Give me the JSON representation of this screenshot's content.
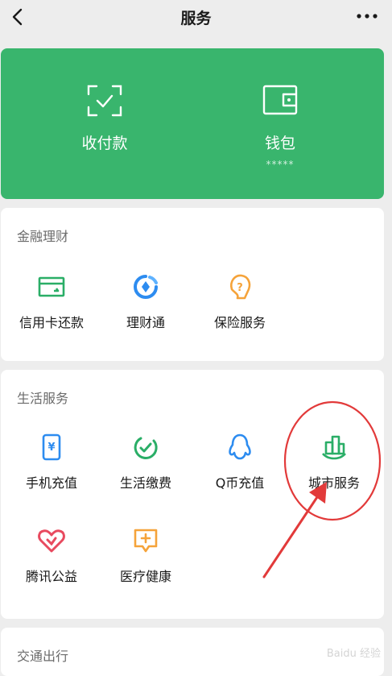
{
  "header": {
    "title": "服务",
    "back_icon": "chevron-left-icon",
    "more_icon": "more-dots-icon"
  },
  "top_card": {
    "color": "#39b56d",
    "items": [
      {
        "label": "收付款",
        "icon": "scan-qr-icon"
      },
      {
        "label": "钱包",
        "icon": "wallet-icon",
        "sub": "*****"
      }
    ]
  },
  "finance": {
    "title": "金融理财",
    "items": [
      {
        "label": "信用卡还款",
        "icon": "credit-card-icon",
        "color": "#2aae67"
      },
      {
        "label": "理财通",
        "icon": "wealth-icon",
        "color": "#2d8cf0"
      },
      {
        "label": "保险服务",
        "icon": "insurance-icon",
        "color": "#f5a33a"
      }
    ]
  },
  "life": {
    "title": "生活服务",
    "items": [
      {
        "label": "手机充值",
        "icon": "phone-topup-icon",
        "color": "#2d8cf0"
      },
      {
        "label": "生活缴费",
        "icon": "bill-pay-icon",
        "color": "#2aae67"
      },
      {
        "label": "Q币充值",
        "icon": "qq-penguin-icon",
        "color": "#2d8cf0"
      },
      {
        "label": "城市服务",
        "icon": "city-icon",
        "color": "#2aae67"
      },
      {
        "label": "腾讯公益",
        "icon": "charity-heart-icon",
        "color": "#e84a5f"
      },
      {
        "label": "医疗健康",
        "icon": "medical-icon",
        "color": "#f5a33a"
      }
    ]
  },
  "transport": {
    "title": "交通出行"
  },
  "annotation_color": "#e23a3a",
  "watermark": "Baidu 经验"
}
